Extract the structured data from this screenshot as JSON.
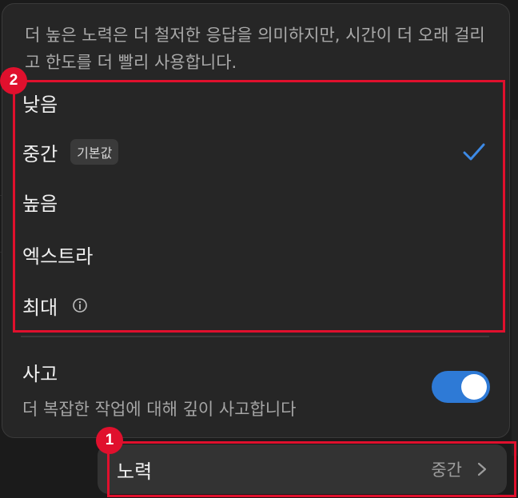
{
  "effort_menu": {
    "description": "더 높은 노력은 더 철저한 응답을 의미하지만, 시간이 더 오래 걸리고 한도를 더 빨리 사용합니다.",
    "options": [
      {
        "label": "낮음",
        "selected": false
      },
      {
        "label": "중간",
        "badge": "기본값",
        "selected": true
      },
      {
        "label": "높음",
        "selected": false
      },
      {
        "label": "엑스트라",
        "selected": false
      },
      {
        "label": "최대",
        "selected": false,
        "has_info": true
      }
    ]
  },
  "thinking": {
    "title": "사고",
    "description": "더 복잡한 작업에 대해 깊이 사고합니다",
    "enabled": true
  },
  "effort_row": {
    "label": "노력",
    "value": "중간"
  },
  "annotations": [
    {
      "number": "1"
    },
    {
      "number": "2"
    }
  ],
  "colors": {
    "accent": "#2e7ad6",
    "annotation": "#e0102d"
  },
  "icons": {
    "check": "check-icon",
    "info": "info-icon",
    "chevron": "chevron-right-icon"
  }
}
